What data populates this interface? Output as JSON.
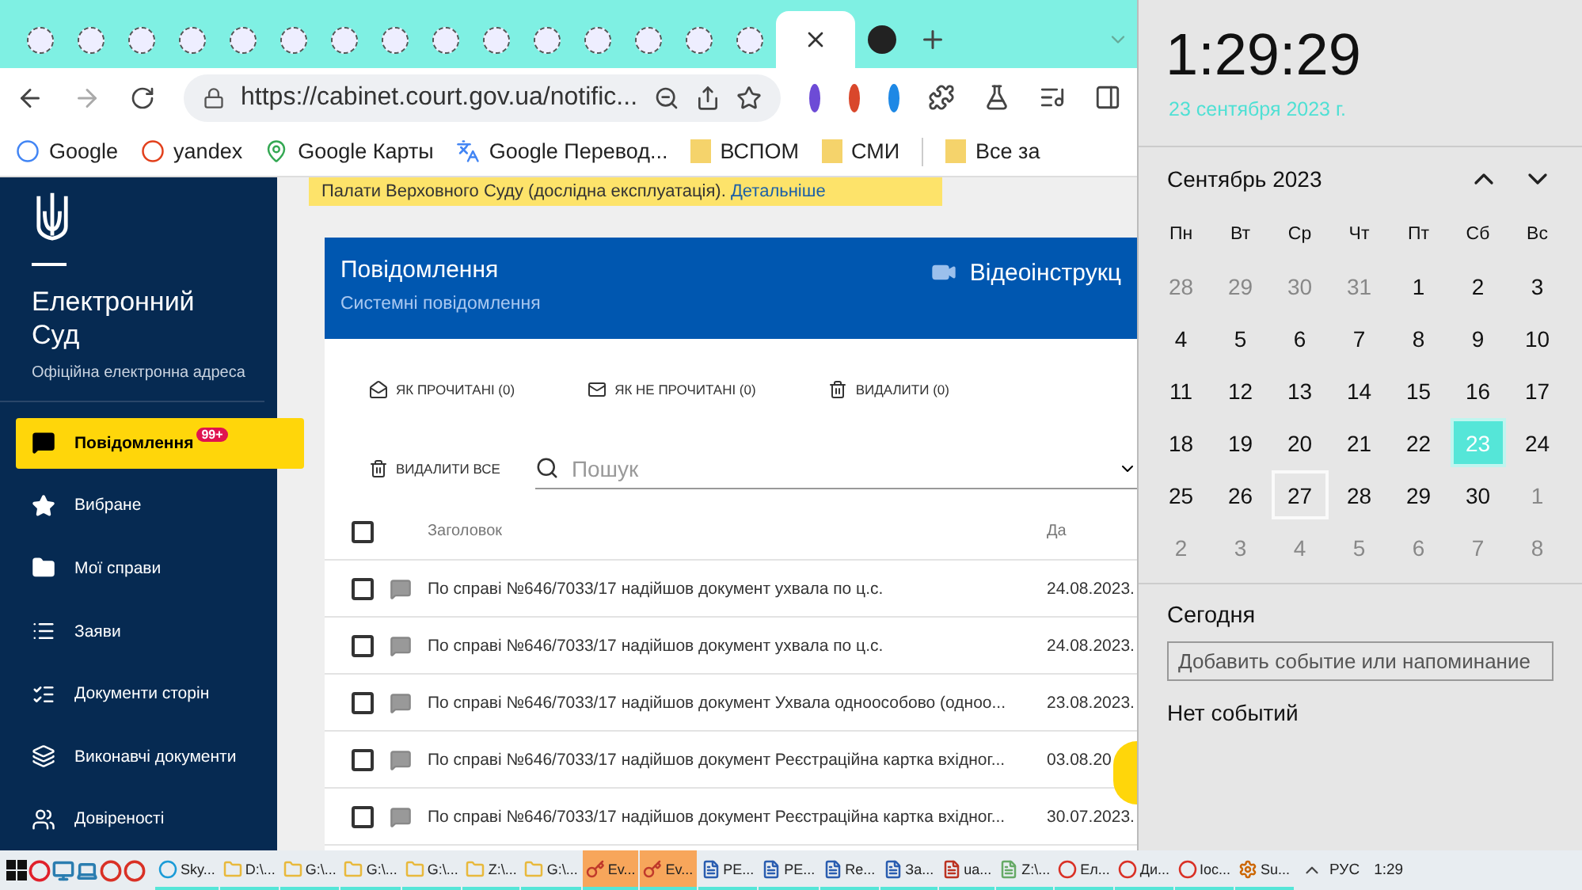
{
  "browser": {
    "tabs": [
      {
        "kind": "favicon",
        "selected": false
      },
      {
        "kind": "favicon",
        "selected": false
      },
      {
        "kind": "favicon",
        "selected": false
      },
      {
        "kind": "favicon",
        "selected": false
      },
      {
        "kind": "favicon",
        "selected": false
      },
      {
        "kind": "favicon",
        "selected": false
      },
      {
        "kind": "favicon",
        "selected": false
      },
      {
        "kind": "favicon",
        "selected": false
      },
      {
        "kind": "favicon",
        "selected": false
      },
      {
        "kind": "favicon",
        "selected": false
      },
      {
        "kind": "favicon",
        "selected": false
      },
      {
        "kind": "favicon",
        "selected": false
      },
      {
        "kind": "favicon",
        "selected": false
      },
      {
        "kind": "favicon",
        "selected": false
      },
      {
        "kind": "favicon",
        "selected": false
      },
      {
        "kind": "page",
        "selected": true
      },
      {
        "kind": "avatar",
        "selected": false
      }
    ],
    "address": {
      "url": "https://cabinet.court.gov.ua/notific..."
    },
    "bookmarks": [
      {
        "label": "Google",
        "kind": "google"
      },
      {
        "label": "yandex",
        "kind": "yandex"
      },
      {
        "label": "Google Карты",
        "kind": "maps"
      },
      {
        "label": "Google Перевод...",
        "kind": "translate"
      },
      {
        "label": "ВСПОМ",
        "kind": "folder"
      },
      {
        "label": "СМИ",
        "kind": "folder"
      }
    ],
    "other_bookmarks": {
      "label": "Все за"
    }
  },
  "site": {
    "brand": {
      "title": "Електронний Суд",
      "subtitle": "Офіційна електронна адреса"
    },
    "nav": [
      {
        "label": "Повідомлення",
        "kind": "message",
        "selected": true,
        "badge": "99+"
      },
      {
        "label": "Вибране",
        "kind": "star",
        "selected": false
      },
      {
        "label": "Мої справи",
        "kind": "folder",
        "selected": false
      },
      {
        "label": "Заяви",
        "kind": "list",
        "selected": false
      },
      {
        "label": "Документи сторін",
        "kind": "checklist",
        "selected": false
      },
      {
        "label": "Виконавчі документи",
        "kind": "layers",
        "selected": false
      },
      {
        "label": "Довіреності",
        "kind": "people",
        "selected": false
      }
    ],
    "banner": {
      "text": "Палати Верховного Суду (дослідна експлуатація).",
      "link": "Детальніше"
    },
    "panel": {
      "title": "Повідомлення",
      "subtitle": "Системні повідомлення",
      "video": "Відеоінструкц",
      "actions": [
        {
          "label": "ЯК ПРОЧИТАНІ (0)",
          "kind": "read"
        },
        {
          "label": "ЯК НЕ ПРОЧИТАНІ (0)",
          "kind": "unread"
        },
        {
          "label": "ВИДАЛИТИ (0)",
          "kind": "delete"
        }
      ],
      "delete_all": "ВИДАЛИТИ ВСЕ",
      "search": {
        "placeholder": "Пошук"
      },
      "columns": [
        "Заголовок",
        "Да"
      ],
      "select_all": {
        "checked": false
      },
      "rows": [
        {
          "checked": false,
          "title": "По справі №646/7033/17 надійшов документ ухвала по ц.с.",
          "date": "24.08.2023."
        },
        {
          "checked": false,
          "title": "По справі №646/7033/17 надійшов документ ухвала по ц.с.",
          "date": "24.08.2023."
        },
        {
          "checked": false,
          "title": "По справі №646/7033/17 надійшов документ Ухвала одноособово (одноо...",
          "date": "23.08.2023."
        },
        {
          "checked": false,
          "title": "По справі №646/7033/17 надійшов документ Реєстраційна картка вхідног...",
          "date": "03.08.20"
        },
        {
          "checked": false,
          "title": "По справі №646/7033/17 надійшов документ Реєстраційна картка вхідног...",
          "date": "30.07.2023."
        }
      ]
    }
  },
  "clock": {
    "time": "1:29:29",
    "date": "23 сентября 2023 г.",
    "month": "Сентябрь 2023",
    "weekdays": [
      "Пн",
      "Вт",
      "Ср",
      "Чт",
      "Пт",
      "Сб",
      "Вс"
    ],
    "days": [
      {
        "label": "28",
        "in_month": false,
        "selected": false,
        "focused": false
      },
      {
        "label": "29",
        "in_month": false,
        "selected": false,
        "focused": false
      },
      {
        "label": "30",
        "in_month": false,
        "selected": false,
        "focused": false
      },
      {
        "label": "31",
        "in_month": false,
        "selected": false,
        "focused": false
      },
      {
        "label": "1",
        "in_month": true,
        "selected": false,
        "focused": false
      },
      {
        "label": "2",
        "in_month": true,
        "selected": false,
        "focused": false
      },
      {
        "label": "3",
        "in_month": true,
        "selected": false,
        "focused": false
      },
      {
        "label": "4",
        "in_month": true,
        "selected": false,
        "focused": false
      },
      {
        "label": "5",
        "in_month": true,
        "selected": false,
        "focused": false
      },
      {
        "label": "6",
        "in_month": true,
        "selected": false,
        "focused": false
      },
      {
        "label": "7",
        "in_month": true,
        "selected": false,
        "focused": false
      },
      {
        "label": "8",
        "in_month": true,
        "selected": false,
        "focused": false
      },
      {
        "label": "9",
        "in_month": true,
        "selected": false,
        "focused": false
      },
      {
        "label": "10",
        "in_month": true,
        "selected": false,
        "focused": false
      },
      {
        "label": "11",
        "in_month": true,
        "selected": false,
        "focused": false
      },
      {
        "label": "12",
        "in_month": true,
        "selected": false,
        "focused": false
      },
      {
        "label": "13",
        "in_month": true,
        "selected": false,
        "focused": false
      },
      {
        "label": "14",
        "in_month": true,
        "selected": false,
        "focused": false
      },
      {
        "label": "15",
        "in_month": true,
        "selected": false,
        "focused": false
      },
      {
        "label": "16",
        "in_month": true,
        "selected": false,
        "focused": false
      },
      {
        "label": "17",
        "in_month": true,
        "selected": false,
        "focused": false
      },
      {
        "label": "18",
        "in_month": true,
        "selected": false,
        "focused": false
      },
      {
        "label": "19",
        "in_month": true,
        "selected": false,
        "focused": false
      },
      {
        "label": "20",
        "in_month": true,
        "selected": false,
        "focused": false
      },
      {
        "label": "21",
        "in_month": true,
        "selected": false,
        "focused": false
      },
      {
        "label": "22",
        "in_month": true,
        "selected": false,
        "focused": false
      },
      {
        "label": "23",
        "in_month": true,
        "selected": true,
        "focused": false
      },
      {
        "label": "24",
        "in_month": true,
        "selected": false,
        "focused": false
      },
      {
        "label": "25",
        "in_month": true,
        "selected": false,
        "focused": false
      },
      {
        "label": "26",
        "in_month": true,
        "selected": false,
        "focused": false
      },
      {
        "label": "27",
        "in_month": true,
        "selected": false,
        "focused": true
      },
      {
        "label": "28",
        "in_month": true,
        "selected": false,
        "focused": false
      },
      {
        "label": "29",
        "in_month": true,
        "selected": false,
        "focused": false
      },
      {
        "label": "30",
        "in_month": true,
        "selected": false,
        "focused": false
      },
      {
        "label": "1",
        "in_month": false,
        "selected": false,
        "focused": false
      },
      {
        "label": "2",
        "in_month": false,
        "selected": false,
        "focused": false
      },
      {
        "label": "3",
        "in_month": false,
        "selected": false,
        "focused": false
      },
      {
        "label": "4",
        "in_month": false,
        "selected": false,
        "focused": false
      },
      {
        "label": "5",
        "in_month": false,
        "selected": false,
        "focused": false
      },
      {
        "label": "6",
        "in_month": false,
        "selected": false,
        "focused": false
      },
      {
        "label": "7",
        "in_month": false,
        "selected": false,
        "focused": false
      },
      {
        "label": "8",
        "in_month": false,
        "selected": false,
        "focused": false
      }
    ],
    "today": "Сегодня",
    "event": {
      "placeholder": "Добавить событие или напоминание"
    },
    "no_events": "Нет событий"
  },
  "taskbar": {
    "pinned": [
      {
        "kind": "opera"
      },
      {
        "kind": "display"
      },
      {
        "kind": "computer"
      },
      {
        "kind": "chrome"
      },
      {
        "kind": "chrome"
      }
    ],
    "windows": [
      {
        "label": "Sky...",
        "kind": "skype",
        "selected": false
      },
      {
        "label": "D:\\...",
        "kind": "folder",
        "selected": false
      },
      {
        "label": "G:\\...",
        "kind": "folder",
        "selected": false
      },
      {
        "label": "G:\\...",
        "kind": "folder",
        "selected": false
      },
      {
        "label": "G:\\...",
        "kind": "folder",
        "selected": false
      },
      {
        "label": "Z:\\...",
        "kind": "folder",
        "selected": false
      },
      {
        "label": "G:\\...",
        "kind": "folder",
        "selected": false
      },
      {
        "label": "Ev...",
        "kind": "key",
        "selected": true
      },
      {
        "label": "Ev...",
        "kind": "key",
        "selected": true
      },
      {
        "label": "PE...",
        "kind": "doc",
        "selected": false
      },
      {
        "label": "PE...",
        "kind": "doc",
        "selected": false
      },
      {
        "label": "Re...",
        "kind": "doc",
        "selected": false
      },
      {
        "label": "За...",
        "kind": "doc",
        "selected": false
      },
      {
        "label": "ua...",
        "kind": "ftp",
        "selected": false
      },
      {
        "label": "Z:\\...",
        "kind": "notepad",
        "selected": false
      },
      {
        "label": "Ел...",
        "kind": "chrome",
        "selected": false
      },
      {
        "label": "Ди...",
        "kind": "chrome",
        "selected": false
      },
      {
        "label": "Ioc...",
        "kind": "chrome",
        "selected": false
      },
      {
        "label": "Su...",
        "kind": "gear",
        "selected": false
      }
    ],
    "language": "РУС",
    "time": "1:29"
  }
}
